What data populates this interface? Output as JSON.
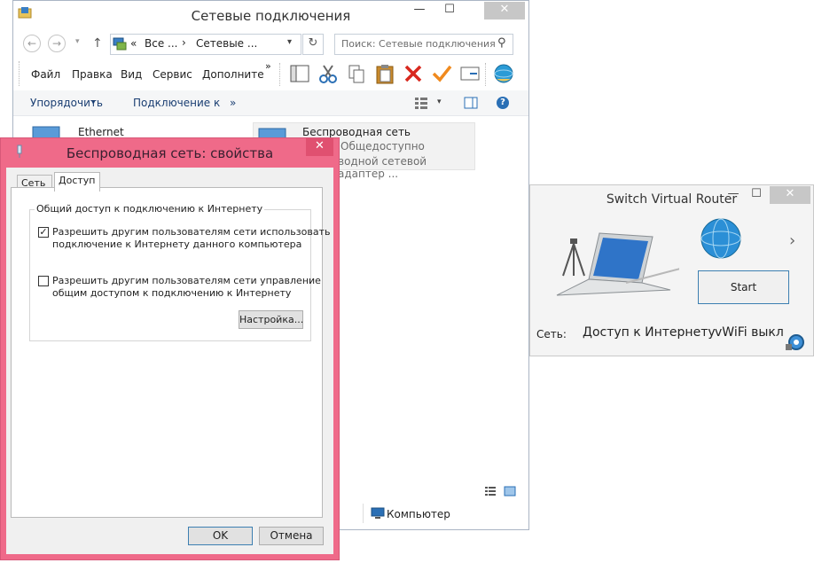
{
  "explorer": {
    "title": "Сетевые подключения",
    "address_parts": [
      "«",
      "Все ...",
      "›",
      "Сетевые ..."
    ],
    "search_placeholder": "Поиск: Сетевые подключения",
    "menu": [
      "Файл",
      "Правка",
      "Вид",
      "Сервис",
      "Дополните"
    ],
    "menu_overflow": "»",
    "commands": [
      "Упорядочить",
      "Подключение к"
    ],
    "commands_overflow": "»",
    "items": [
      {
        "title": "Ethernet",
        "sub1": "",
        "sub2": ""
      },
      {
        "title": "Беспроводная сеть",
        "sub1": "Общедоступно",
        "sub2": "водной сетевой адаптер ..."
      }
    ],
    "status_computer": "Компьютер"
  },
  "props": {
    "title": "Беспроводная сеть: свойства",
    "tabs": [
      "Сеть",
      "Доступ"
    ],
    "group_title": "Общий доступ к подключению к Интернету",
    "options": [
      {
        "checked": true,
        "line1": "Разрешить другим пользователям сети использовать",
        "line2": "подключение к Интернету данного компьютера"
      },
      {
        "checked": false,
        "line1": "Разрешить другим пользователям сети управление",
        "line2": "общим доступом к подключению к Интернету"
      }
    ],
    "settings_button": "Настройка...",
    "ok": "OK",
    "cancel": "Отмена",
    "check_glyph": "✓"
  },
  "router": {
    "title": "Switch Virtual Router",
    "start": "Start",
    "net_label": "Сеть:",
    "net_value": "Доступ к Интернету",
    "wifi_status": "vWiFi выкл",
    "arrow": "›"
  },
  "glyphs": {
    "minimize": "—",
    "maximize": "☐",
    "close": "✕",
    "back": "←",
    "forward": "→",
    "up": "↑",
    "refresh": "↻",
    "search": "⚲",
    "dropdown": "▾",
    "help": "?"
  },
  "colors": {
    "dialog_frame": "#ef6a89",
    "command_text": "#1a3e72",
    "accent_blue": "#3c7fb1"
  }
}
